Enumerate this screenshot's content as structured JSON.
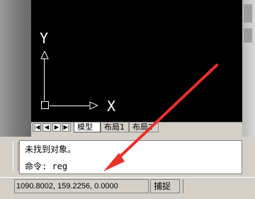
{
  "axes": {
    "y_label": "Y",
    "x_label": "X"
  },
  "layout_tabs": {
    "nav_buttons": [
      "first",
      "prev",
      "next",
      "last"
    ],
    "tabs": [
      {
        "label": "模型",
        "active": true
      },
      {
        "label": "布局1",
        "active": false
      },
      {
        "label": "布局2",
        "active": false
      }
    ]
  },
  "command": {
    "line1": "未找到对象。",
    "line2": "命令: reg"
  },
  "status": {
    "coordinates": "1090.8002, 159.2256, 0.0000",
    "snap_label": "捕捉"
  },
  "annotation": {
    "arrow_color": "#e8312a"
  }
}
